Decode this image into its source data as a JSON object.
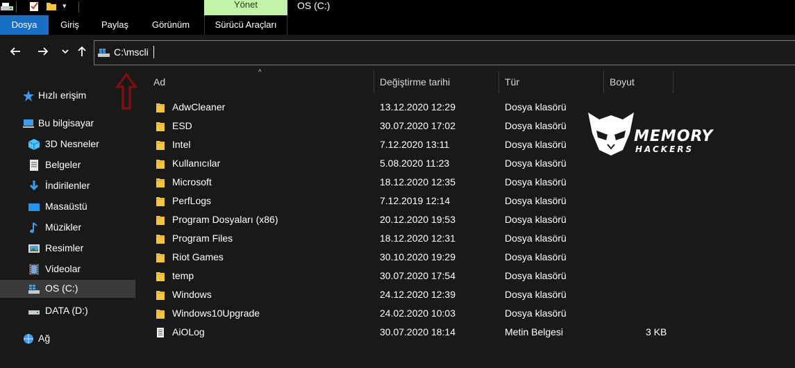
{
  "window": {
    "title": "OS (C:)",
    "manage_tab": "Yönet"
  },
  "ribbon": {
    "tabs": [
      "Dosya",
      "Giriş",
      "Paylaş",
      "Görünüm",
      "Sürücü Araçları"
    ],
    "file_tab_color": "#1a6fc4",
    "manage_color": "#c2f3a9"
  },
  "address": {
    "path": "C:\\mscli"
  },
  "sidebar": {
    "items": [
      {
        "label": "Hızlı erişim",
        "icon": "star-icon"
      },
      {
        "label": "Bu bilgisayar",
        "icon": "computer-icon"
      },
      {
        "label": "3D Nesneler",
        "icon": "cube-icon"
      },
      {
        "label": "Belgeler",
        "icon": "document-icon"
      },
      {
        "label": "İndirilenler",
        "icon": "download-icon"
      },
      {
        "label": "Masaüstü",
        "icon": "desktop-icon"
      },
      {
        "label": "Müzikler",
        "icon": "music-icon"
      },
      {
        "label": "Resimler",
        "icon": "pictures-icon"
      },
      {
        "label": "Videolar",
        "icon": "video-icon"
      },
      {
        "label": "OS (C:)",
        "icon": "windows-drive-icon",
        "selected": true
      },
      {
        "label": "DATA (D:)",
        "icon": "drive-icon"
      },
      {
        "label": "Ağ",
        "icon": "network-icon"
      }
    ]
  },
  "list": {
    "columns": [
      "Ad",
      "Değiştirme tarihi",
      "Tür",
      "Boyut"
    ],
    "rows": [
      {
        "name": "AdwCleaner",
        "date": "13.12.2020 12:29",
        "type": "Dosya klasörü",
        "size": "",
        "kind": "folder"
      },
      {
        "name": "ESD",
        "date": "30.07.2020 17:02",
        "type": "Dosya klasörü",
        "size": "",
        "kind": "folder"
      },
      {
        "name": "Intel",
        "date": "7.12.2020 13:11",
        "type": "Dosya klasörü",
        "size": "",
        "kind": "folder"
      },
      {
        "name": "Kullanıcılar",
        "date": "5.08.2020 11:23",
        "type": "Dosya klasörü",
        "size": "",
        "kind": "folder"
      },
      {
        "name": "Microsoft",
        "date": "18.12.2020 12:35",
        "type": "Dosya klasörü",
        "size": "",
        "kind": "folder"
      },
      {
        "name": "PerfLogs",
        "date": "7.12.2019 12:14",
        "type": "Dosya klasörü",
        "size": "",
        "kind": "folder"
      },
      {
        "name": "Program Dosyaları (x86)",
        "date": "20.12.2020 19:53",
        "type": "Dosya klasörü",
        "size": "",
        "kind": "folder"
      },
      {
        "name": "Program Files",
        "date": "18.12.2020 12:31",
        "type": "Dosya klasörü",
        "size": "",
        "kind": "folder"
      },
      {
        "name": "Riot Games",
        "date": "30.10.2020 19:29",
        "type": "Dosya klasörü",
        "size": "",
        "kind": "folder"
      },
      {
        "name": "temp",
        "date": "30.07.2020 17:54",
        "type": "Dosya klasörü",
        "size": "",
        "kind": "folder"
      },
      {
        "name": "Windows",
        "date": "24.12.2020 12:39",
        "type": "Dosya klasörü",
        "size": "",
        "kind": "folder"
      },
      {
        "name": "Windows10Upgrade",
        "date": "24.02.2020 10:03",
        "type": "Dosya klasörü",
        "size": "",
        "kind": "folder"
      },
      {
        "name": "AiOLog",
        "date": "30.07.2020 18:14",
        "type": "Metin Belgesi",
        "size": "3 KB",
        "kind": "text"
      }
    ]
  },
  "watermark": {
    "line1": "MEMORY",
    "line2": "HACKERS"
  }
}
